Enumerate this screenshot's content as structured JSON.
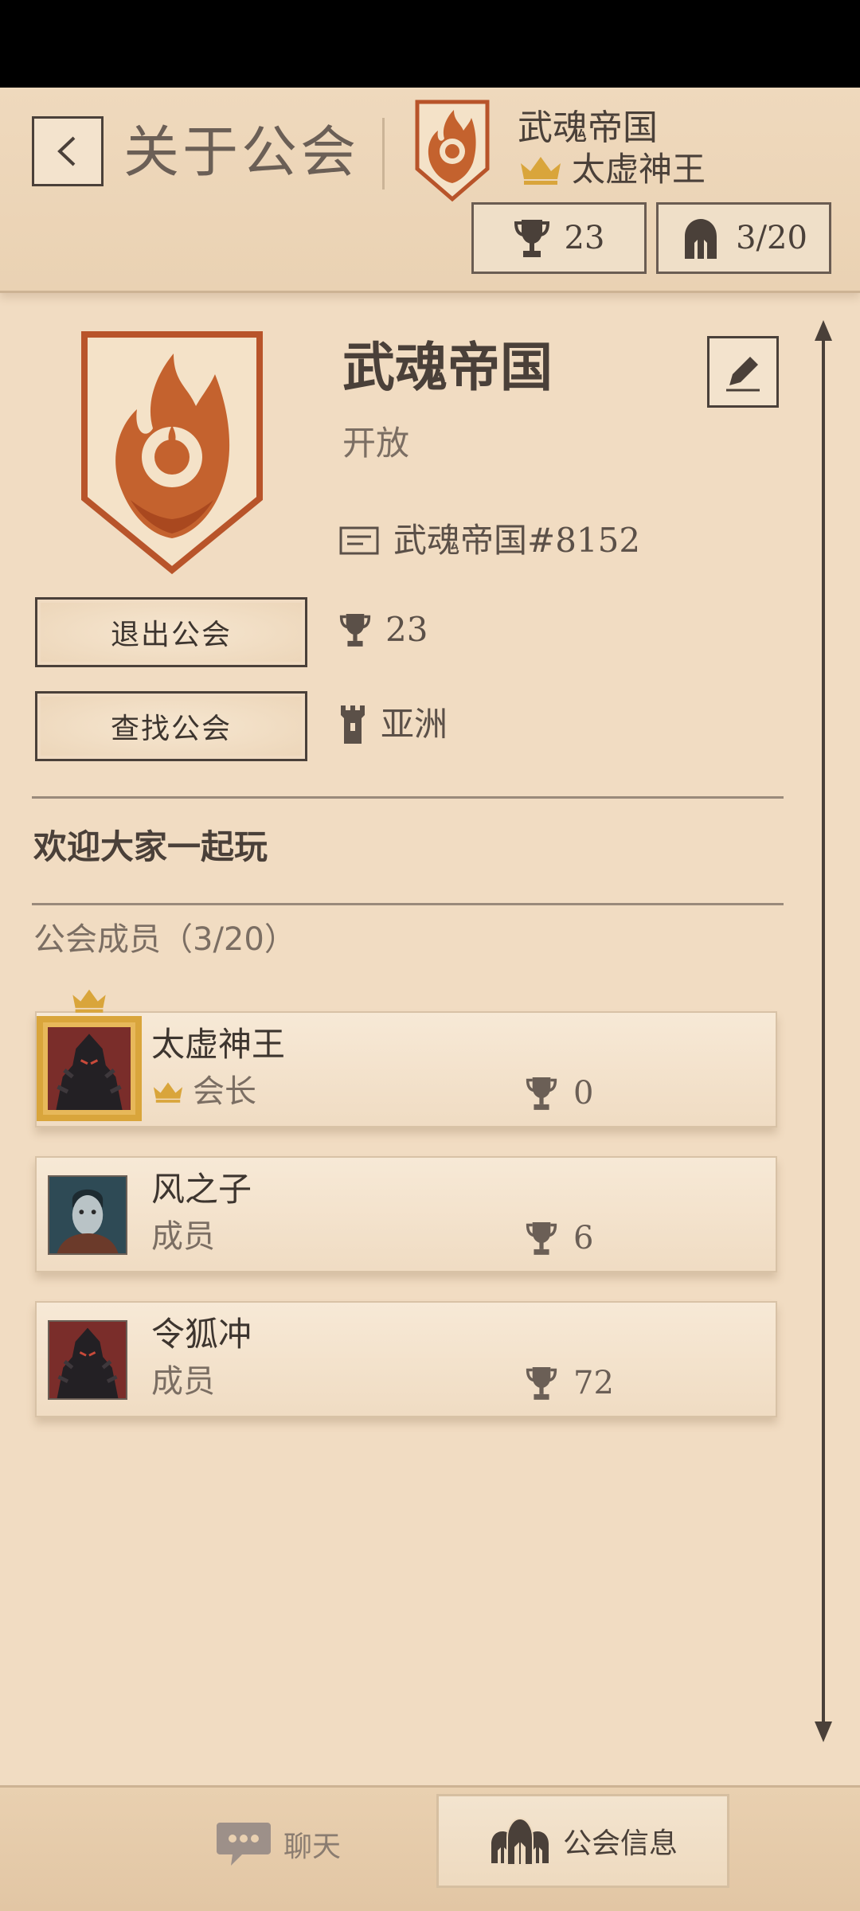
{
  "header": {
    "title": "关于公会",
    "guild_name": "武魂帝国",
    "leader_name": "太虚神王",
    "trophies": "23",
    "members_count": "3/20"
  },
  "guild": {
    "name": "武魂帝国",
    "status": "开放",
    "tag": "武魂帝国#8152",
    "trophies": "23",
    "region": "亚洲",
    "leave_label": "退出公会",
    "find_label": "查找公会",
    "description": "欢迎大家一起玩",
    "members_heading": "公会成员（3/20）"
  },
  "members": [
    {
      "name": "太虚神王",
      "role": "会长",
      "trophies": "0"
    },
    {
      "name": "风之子",
      "role": "成员",
      "trophies": "6"
    },
    {
      "name": "令狐冲",
      "role": "成员",
      "trophies": "72"
    }
  ],
  "nav": {
    "chat_label": "聊天",
    "guild_label": "公会信息"
  },
  "colors": {
    "background": "#f1dcc2",
    "ink": "#4a4039",
    "crest": "#b8542a",
    "gold": "#d9a53b"
  },
  "icons": [
    "back-chevron-icon",
    "trophy-icon",
    "helmet-icon",
    "edit-pencil-icon",
    "id-card-icon",
    "tower-icon",
    "crown-icon",
    "chat-bubble-icon",
    "guild-icon"
  ]
}
